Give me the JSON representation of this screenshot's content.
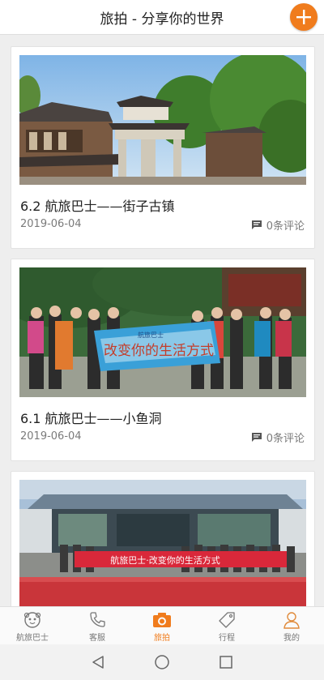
{
  "header": {
    "title": "旅拍 - 分享你的世界",
    "add_icon": "plus-icon"
  },
  "posts": [
    {
      "title": "6.2 航旅巴士——街子古镇",
      "date": "2019-06-04",
      "comments": "0条评论"
    },
    {
      "title": "6.1 航旅巴士——小鱼洞",
      "date": "2019-06-04",
      "comments": "0条评论",
      "banner_text": "改变你的生活方式",
      "banner_brand": "航旅巴士"
    },
    {
      "title": "",
      "date": "",
      "comments": "",
      "banner_text": "航旅巴士·改变你的生活方式"
    }
  ],
  "tabs": [
    {
      "label": "航旅巴士",
      "icon": "mascot-icon",
      "active": false
    },
    {
      "label": "客服",
      "icon": "phone-icon",
      "active": false
    },
    {
      "label": "旅拍",
      "icon": "camera-icon",
      "active": true
    },
    {
      "label": "行程",
      "icon": "tag-icon",
      "active": false
    },
    {
      "label": "我的",
      "icon": "person-icon",
      "active": false
    }
  ],
  "colors": {
    "accent": "#f07c1d",
    "text": "#222222",
    "muted": "#7a7a7a"
  }
}
